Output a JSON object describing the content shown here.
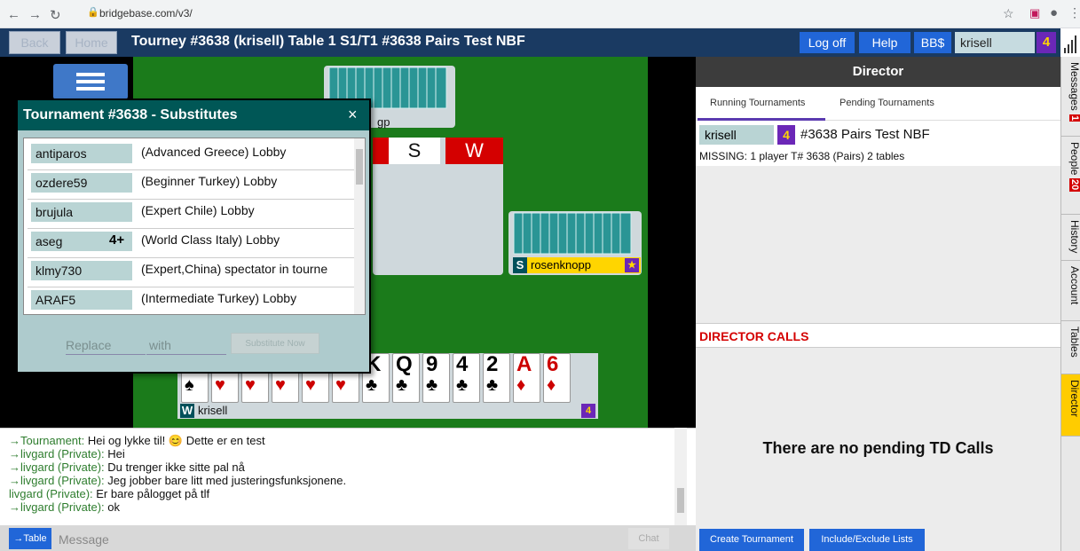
{
  "browser": {
    "url": "bridgebase.com/v3/"
  },
  "appbar": {
    "back": "Back",
    "home": "Home",
    "title": "Tourney #3638 (krisell) Table 1 S1/T1 #3638 Pairs Test NBF",
    "logoff": "Log off",
    "help": "Help",
    "bbs": "BB$",
    "user": "krisell",
    "user_badge": "4"
  },
  "table": {
    "north_name": "gp",
    "trick_seats": [
      "S",
      "W"
    ],
    "east": {
      "seat": "S",
      "name": "rosenknopp",
      "badge": "★"
    },
    "south": {
      "seat": "W",
      "name": "krisell",
      "badge": "4"
    },
    "hand": [
      {
        "rank": "",
        "suit": "♠",
        "color": "#000"
      },
      {
        "rank": "",
        "suit": "♥",
        "color": "#c00"
      },
      {
        "rank": "",
        "suit": "♥",
        "color": "#c00"
      },
      {
        "rank": "",
        "suit": "♥",
        "color": "#c00"
      },
      {
        "rank": "",
        "suit": "♥",
        "color": "#c00"
      },
      {
        "rank": "",
        "suit": "♥",
        "color": "#c00"
      },
      {
        "rank": "K",
        "suit": "♣",
        "color": "#000"
      },
      {
        "rank": "Q",
        "suit": "♣",
        "color": "#000"
      },
      {
        "rank": "9",
        "suit": "♣",
        "color": "#000"
      },
      {
        "rank": "4",
        "suit": "♣",
        "color": "#000"
      },
      {
        "rank": "2",
        "suit": "♣",
        "color": "#000"
      },
      {
        "rank": "A",
        "suit": "♦",
        "color": "#c00"
      },
      {
        "rank": "6",
        "suit": "♦",
        "color": "#c00"
      }
    ]
  },
  "dialog": {
    "title": "Tournament #3638 - Substitutes",
    "close": "×",
    "players": [
      {
        "name": "antiparos",
        "badge": "",
        "info": "(Advanced Greece) Lobby"
      },
      {
        "name": "ozdere59",
        "badge": "",
        "info": "(Beginner Turkey) Lobby"
      },
      {
        "name": "brujula",
        "badge": "",
        "info": "(Expert Chile) Lobby"
      },
      {
        "name": "aseg",
        "badge": "4+",
        "info": "(World Class Italy) Lobby"
      },
      {
        "name": "klmy730",
        "badge": "",
        "info": "(Expert,China) spectator in tourne"
      },
      {
        "name": "ARAF5",
        "badge": "",
        "info": "(Intermediate Turkey) Lobby"
      }
    ],
    "replace_placeholder": "Replace",
    "with_placeholder": "with",
    "substitute_button": "Substitute Now"
  },
  "chat": {
    "lines": [
      {
        "who": "→Tournament:",
        "text": " Hei og lykke til! 😊 Dette er en test"
      },
      {
        "who": "→livgard (Private):",
        "text": " Hei"
      },
      {
        "who": "→livgard (Private):",
        "text": " Du trenger ikke sitte pal nå"
      },
      {
        "who": "→livgard (Private):",
        "text": " Jeg jobber bare litt med justeringsfunksjonene."
      },
      {
        "who": "livgard (Private):",
        "text": " Er bare pålogget på tlf"
      },
      {
        "who": "→livgard (Private):",
        "text": " ok"
      }
    ],
    "table_button": "→Table",
    "message_placeholder": "Message",
    "chat_button": "Chat"
  },
  "director": {
    "header": "Director",
    "tab_running": "Running Tournaments",
    "tab_pending": "Pending Tournaments",
    "tourney_user": "krisell",
    "tourney_badge": "4",
    "tourney_name": "#3638 Pairs Test NBF",
    "missing": "MISSING: 1 player T# 3638 (Pairs) 2 tables",
    "calls_header": "DIRECTOR CALLS",
    "no_calls": "There are no pending TD Calls",
    "create_button": "Create Tournament",
    "lists_button": "Include/Exclude Lists"
  },
  "sidetabs": [
    {
      "label": "Messages",
      "badge": "1"
    },
    {
      "label": "People",
      "badge": "20"
    },
    {
      "label": "History",
      "badge": ""
    },
    {
      "label": "Account",
      "badge": ""
    },
    {
      "label": "Tables",
      "badge": ""
    },
    {
      "label": "Director",
      "badge": ""
    }
  ],
  "colors": {
    "active_side_tab": "#ffcc00",
    "appbar": "#1a3a62",
    "felt": "#1b7b1b"
  }
}
